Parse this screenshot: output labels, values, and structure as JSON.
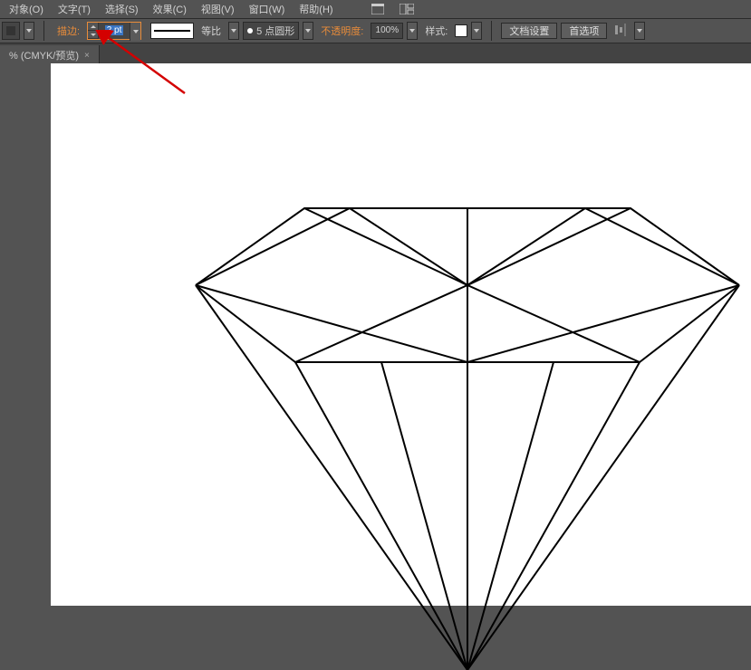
{
  "menu": {
    "object": "对象(O)",
    "type": "文字(T)",
    "select": "选择(S)",
    "effect": "效果(C)",
    "view": "视图(V)",
    "window": "窗口(W)",
    "help": "帮助(H)"
  },
  "toolbar": {
    "stroke_label": "描边:",
    "stroke_value": "2 pt",
    "profile_label": "等比",
    "brush_text": "5 点圆形",
    "opacity_label": "不透明度:",
    "opacity_value": "100%",
    "style_label": "样式:",
    "doc_setup": "文档设置",
    "preferences": "首选项"
  },
  "tab": {
    "title": "% (CMYK/预览)",
    "close": "×"
  }
}
